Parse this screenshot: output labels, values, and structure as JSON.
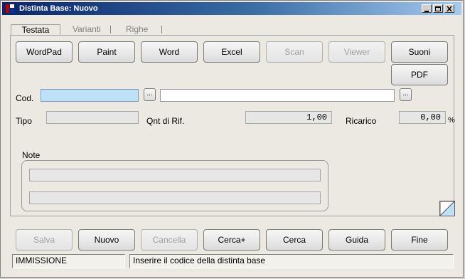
{
  "window": {
    "title": "Distinta Base: Nuovo"
  },
  "tabs": [
    {
      "label": "Testata",
      "active": true
    },
    {
      "label": "Varianti",
      "active": false
    },
    {
      "label": "Righe",
      "active": false
    }
  ],
  "toolbar": {
    "wordpad": "WordPad",
    "paint": "Paint",
    "word": "Word",
    "excel": "Excel",
    "scan": "Scan",
    "viewer": "Viewer",
    "suoni": "Suoni",
    "pdf": "PDF"
  },
  "form": {
    "cod_label": "Cod.",
    "cod_value": "",
    "desc_value": "",
    "tipo_label": "Tipo",
    "tipo_value": "",
    "qnt_label": "Qnt di Rif.",
    "qnt_value": "1,00",
    "ricarico_label": "Ricarico",
    "ricarico_value": "0,00",
    "percent": "%",
    "note_label": "Note",
    "dots": "..."
  },
  "actions": {
    "salva": "Salva",
    "nuovo": "Nuovo",
    "cancella": "Cancella",
    "cerca_plus": "Cerca+",
    "cerca": "Cerca",
    "guida": "Guida",
    "fine": "Fine"
  },
  "status": {
    "mode": "IMMISSIONE",
    "message": "Inserire il codice della distinta base"
  }
}
